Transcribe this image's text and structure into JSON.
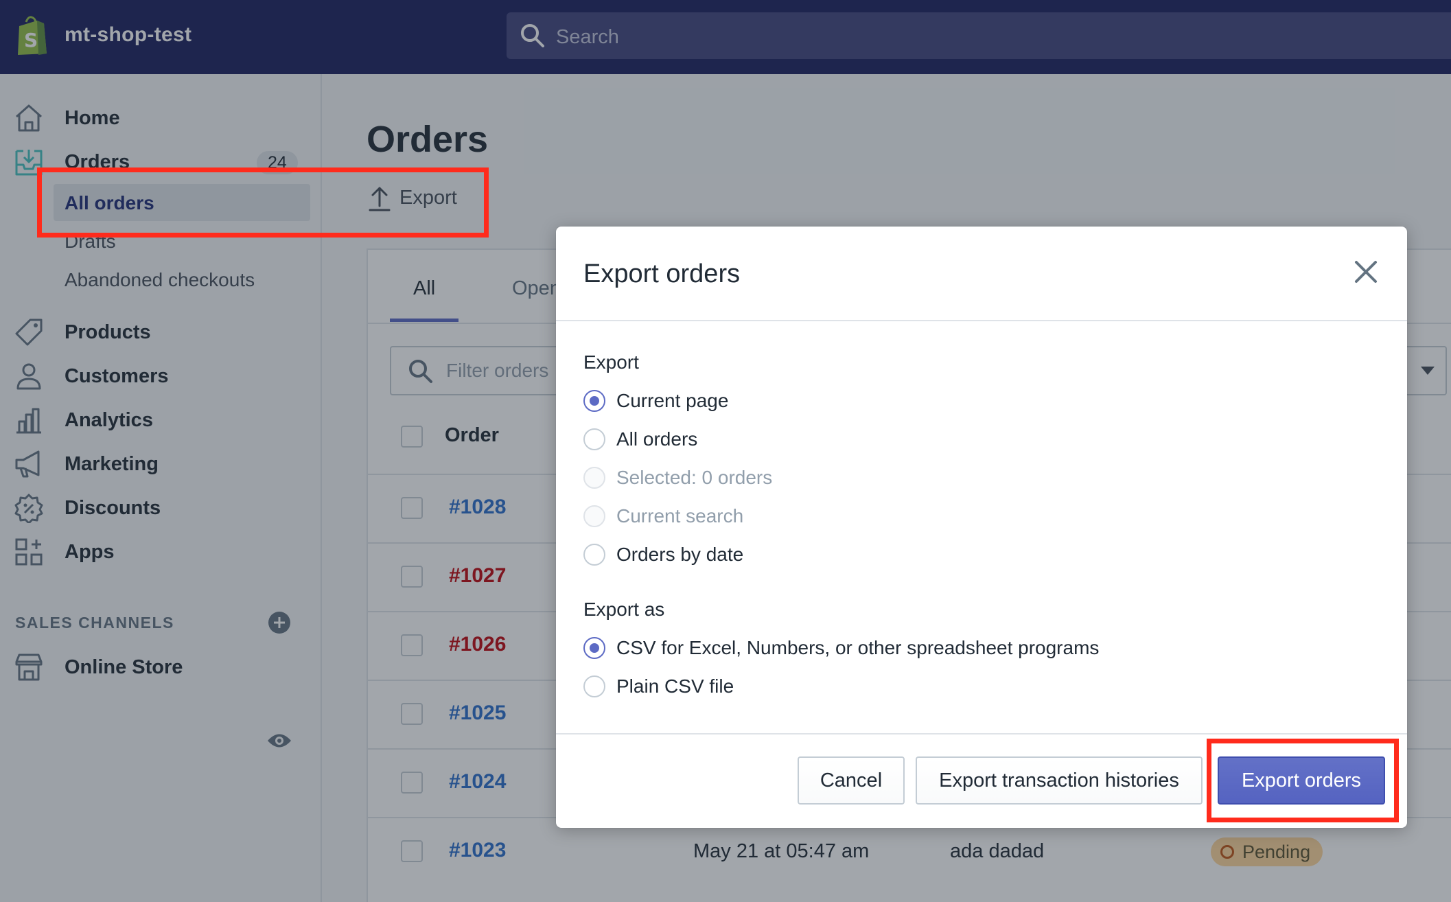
{
  "topbar": {
    "shop_name": "mt-shop-test",
    "search_placeholder": "Search"
  },
  "sidebar": {
    "home": "Home",
    "orders": "Orders",
    "orders_count": "24",
    "sub_all_orders": "All orders",
    "sub_drafts": "Drafts",
    "sub_abandoned": "Abandoned checkouts",
    "products": "Products",
    "customers": "Customers",
    "analytics": "Analytics",
    "marketing": "Marketing",
    "discounts": "Discounts",
    "apps": "Apps",
    "sales_channels": "SALES CHANNELS",
    "online_store": "Online Store"
  },
  "main": {
    "title": "Orders",
    "export_label": "Export",
    "tabs": [
      "All",
      "Open"
    ],
    "filter_placeholder": "Filter orders",
    "column_order": "Order",
    "rows": [
      {
        "order": "#1028",
        "color": "#2c6ecb"
      },
      {
        "order": "#1027",
        "color": "#bf0711"
      },
      {
        "order": "#1026",
        "color": "#bf0711"
      },
      {
        "order": "#1025",
        "color": "#2c6ecb"
      },
      {
        "order": "#1024",
        "color": "#2c6ecb"
      },
      {
        "order": "#1023",
        "color": "#2c6ecb",
        "date": "May 21 at 05:47 am",
        "customer": "ada dadad",
        "status": "Pending"
      }
    ]
  },
  "modal": {
    "title": "Export orders",
    "export_label": "Export",
    "export_options": [
      {
        "label": "Current page",
        "state": "checked"
      },
      {
        "label": "All orders",
        "state": "unchecked"
      },
      {
        "label": "Selected: 0 orders",
        "state": "disabled"
      },
      {
        "label": "Current search",
        "state": "disabled"
      },
      {
        "label": "Orders by date",
        "state": "unchecked"
      }
    ],
    "export_as_label": "Export as",
    "format_options": [
      {
        "label": "CSV for Excel, Numbers, or other spreadsheet programs",
        "state": "checked"
      },
      {
        "label": "Plain CSV file",
        "state": "unchecked"
      }
    ],
    "cancel": "Cancel",
    "export_transactions": "Export transaction histories",
    "export_orders": "Export orders"
  },
  "colors": {
    "topbar": "#1c2260",
    "accent": "#5c6ac4",
    "highlight": "#ff2b1c"
  }
}
